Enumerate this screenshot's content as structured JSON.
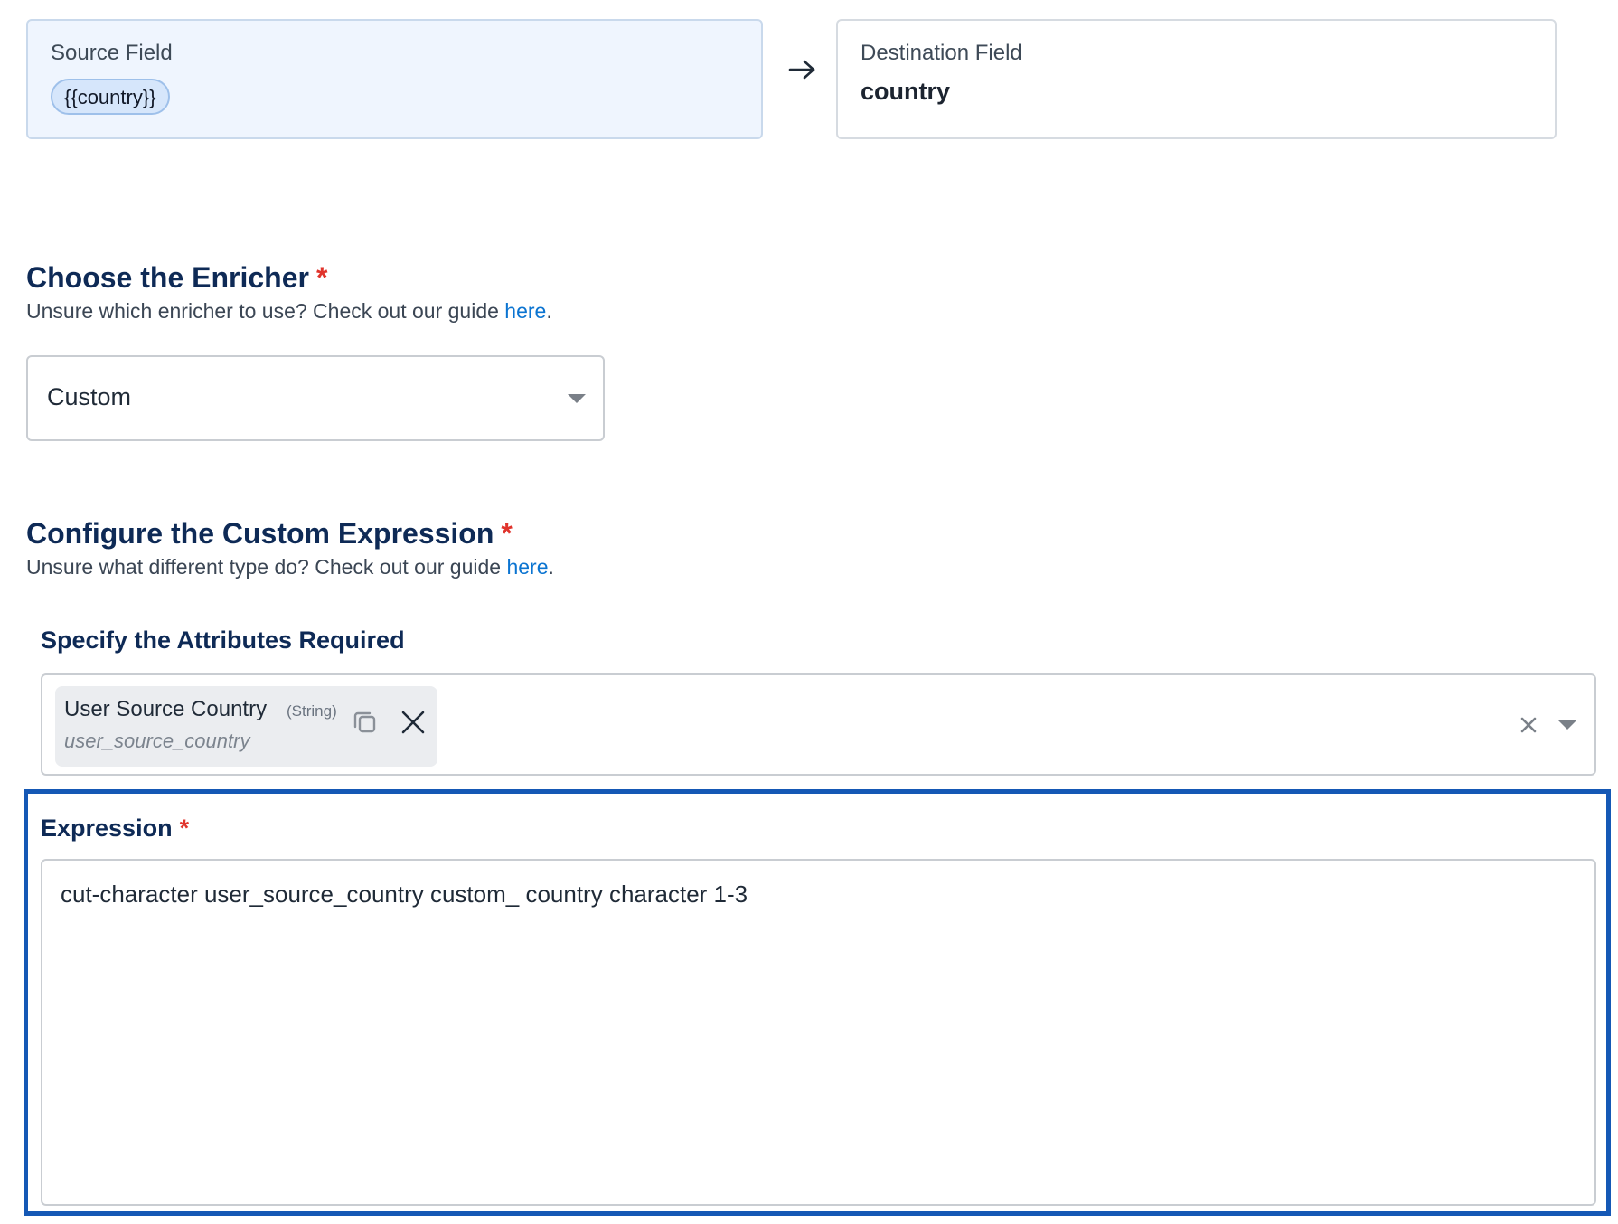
{
  "mapping": {
    "source_label": "Source Field",
    "source_value": "{{country}}",
    "destination_label": "Destination Field",
    "destination_value": "country",
    "arrow_icon": "arrow-right-icon"
  },
  "enricher": {
    "title": "Choose the Enricher",
    "required_mark": "*",
    "hint_prefix": "Unsure which enricher to use? Check out our guide ",
    "hint_link": "here",
    "hint_suffix": ".",
    "selected_value": "Custom",
    "caret_icon": "chevron-down-icon"
  },
  "custom_expression": {
    "title": "Configure the Custom Expression",
    "required_mark": "*",
    "hint_prefix": "Unsure what different type do? Check out our guide ",
    "hint_link": "here",
    "hint_suffix": "."
  },
  "attributes": {
    "title": "Specify the Attributes Required",
    "selected": [
      {
        "name": "User Source Country",
        "type": "(String)",
        "key": "user_source_country",
        "copy_icon": "copy-icon",
        "remove_icon": "close-icon"
      }
    ],
    "clear_icon": "clear-icon",
    "caret_icon": "chevron-down-icon"
  },
  "expression": {
    "label": "Expression",
    "required_mark": "*",
    "value": "cut-character user_source_country custom_ country character 1-3"
  },
  "colors": {
    "heading": "#0e2a56",
    "required": "#e0342c",
    "link": "#0b74d1",
    "focus_border": "#1558b5",
    "source_card_bg": "#eff5fe"
  }
}
